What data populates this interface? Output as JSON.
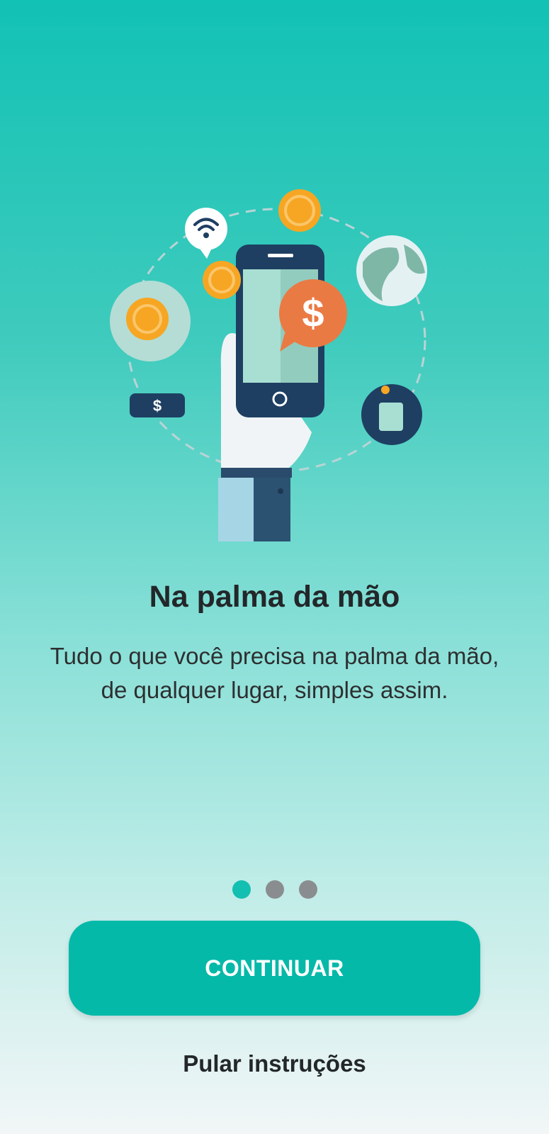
{
  "onboarding": {
    "title": "Na palma da mão",
    "description": "Tudo o que você precisa na palma da mão, de qualquer lugar, simples assim.",
    "pagination": {
      "total": 3,
      "current": 1
    },
    "primary_button_label": "CONTINUAR",
    "skip_label": "Pular instruções"
  },
  "illustration": {
    "icons": [
      "hand-phone-icon",
      "dollar-coin-icon",
      "wifi-icon",
      "globe-icon",
      "cash-bill-icon",
      "money-bag-icon",
      "dollar-chat-bubble-icon"
    ],
    "phone_bubble_symbol": "$",
    "bill_symbol": "$"
  },
  "colors": {
    "accent": "#05b9a9",
    "dot_active": "#13bfb0",
    "dot_inactive": "#8a8d8f",
    "coin": "#f6a623",
    "phone_dark": "#1e3f62",
    "bubble_orange": "#ea7a44"
  }
}
